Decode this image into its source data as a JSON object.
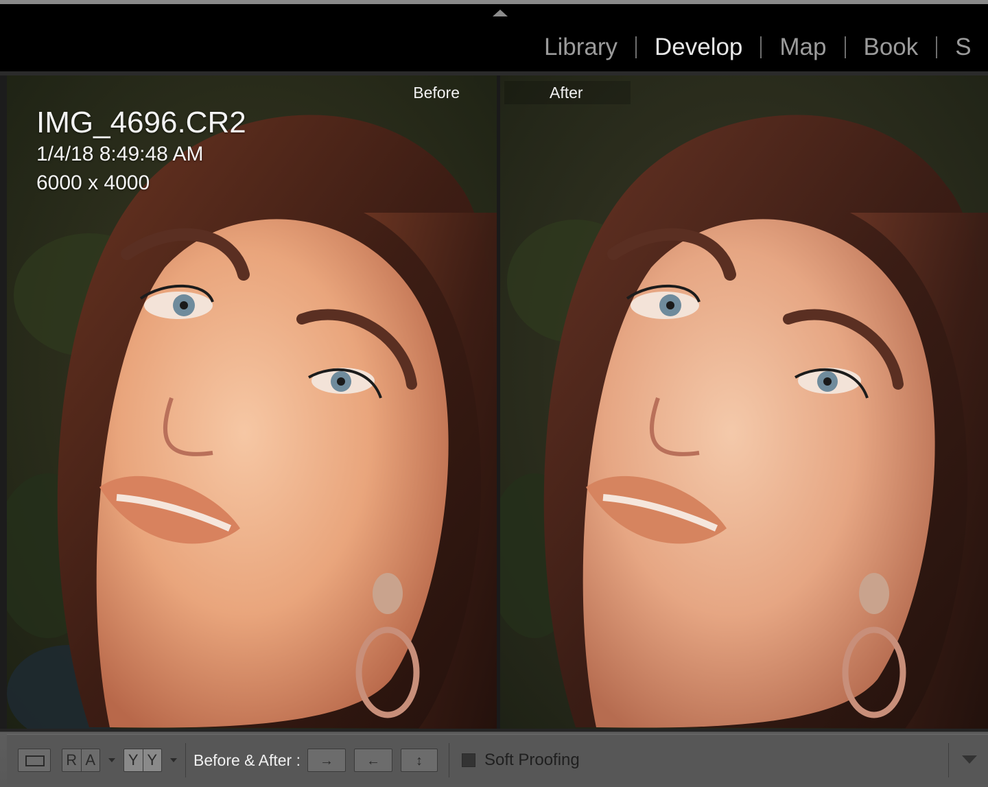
{
  "module_picker": {
    "items": [
      {
        "label": "Library",
        "active": false
      },
      {
        "label": "Develop",
        "active": true
      },
      {
        "label": "Map",
        "active": false
      },
      {
        "label": "Book",
        "active": false
      },
      {
        "label": "S",
        "active": false
      }
    ]
  },
  "panes": {
    "before_label": "Before",
    "after_label": "After"
  },
  "photo_info": {
    "filename": "IMG_4696.CR2",
    "datetime": "1/4/18 8:49:48 AM",
    "dimensions": "6000 x 4000"
  },
  "toolbar": {
    "loupe_icon": "loupe-view-icon",
    "ra_letters": [
      "R",
      "A"
    ],
    "yy_letters": [
      "Y",
      "Y"
    ],
    "before_after_label": "Before & After :",
    "copy_before_to_after_glyph": "→",
    "copy_after_to_before_glyph": "←",
    "swap_glyph": "↕",
    "soft_proofing_label": "Soft Proofing",
    "soft_proofing_checked": false
  },
  "colors": {
    "active_module": "#e8e8e8",
    "inactive_module": "#9b9b9b",
    "toolbar_bg": "#575757"
  }
}
